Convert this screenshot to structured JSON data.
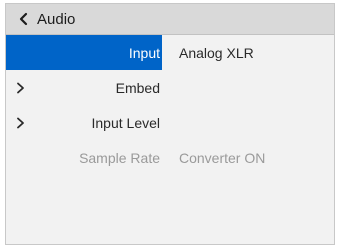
{
  "header": {
    "title": "Audio",
    "back_icon": "chevron-left-icon"
  },
  "menu": {
    "rows": [
      {
        "label": "Input",
        "value": "Analog XLR",
        "selected": true,
        "has_submenu": false,
        "disabled": false
      },
      {
        "label": "Embed",
        "value": "",
        "selected": false,
        "has_submenu": true,
        "disabled": false
      },
      {
        "label": "Input Level",
        "value": "",
        "selected": false,
        "has_submenu": true,
        "disabled": false
      },
      {
        "label": "Sample Rate",
        "value": "Converter ON",
        "selected": false,
        "has_submenu": false,
        "disabled": true
      }
    ]
  },
  "colors": {
    "selection": "#0064c8",
    "header_bg": "#d9d9d9",
    "panel_bg": "#f2f2f2",
    "disabled_text": "#9a9a9a"
  }
}
